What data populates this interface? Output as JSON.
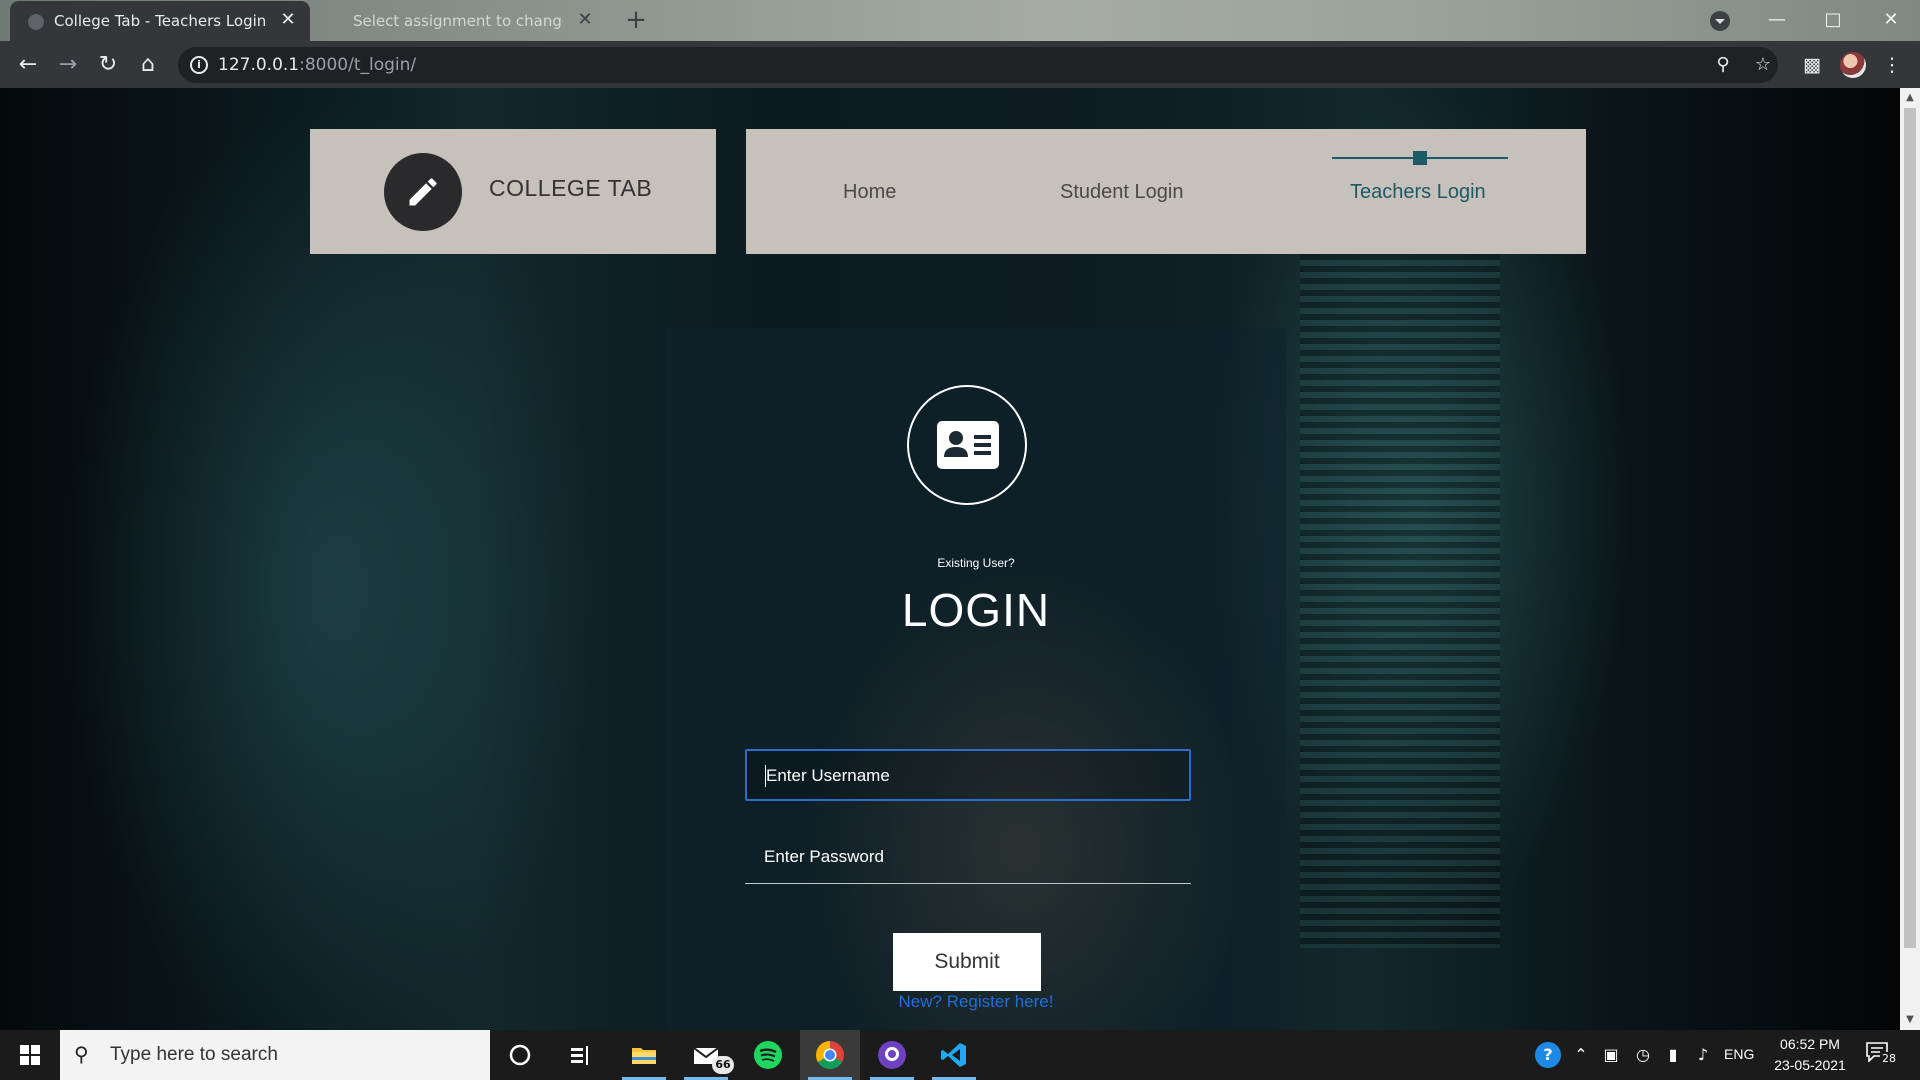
{
  "browser": {
    "tabs": [
      {
        "title": "College Tab - Teachers Login",
        "active": true
      },
      {
        "title": "Select assignment to change | Django",
        "active": false
      }
    ],
    "close_glyph": "✕",
    "new_tab_glyph": "+",
    "url_host": "127.0.0.1",
    "url_rest": ":8000/t_login/",
    "icons": {
      "back": "back-arrow-icon",
      "forward": "forward-arrow-icon",
      "reload": "reload-icon",
      "home": "home-icon",
      "info": "info-icon",
      "zoom": "zoom-icon",
      "bookmark": "star-icon",
      "extensions": "puzzle-icon",
      "menu": "kebab-menu-icon"
    }
  },
  "site": {
    "brand": "COLLEGE TAB",
    "nav": [
      {
        "label": "Home",
        "active": false
      },
      {
        "label": "Student Login",
        "active": false
      },
      {
        "label": "Teachers Login",
        "active": true
      }
    ],
    "accent_color": "#1d5a66"
  },
  "login": {
    "existing_text": "Existing User?",
    "title": "LOGIN",
    "username_placeholder": "Enter Username",
    "password_placeholder": "Enter Password",
    "submit_label": "Submit",
    "register_link": "New? Register here!",
    "link_color": "#1e6fd9"
  },
  "taskbar": {
    "search_placeholder": "Type here to search",
    "mail_badge": "66",
    "language": "ENG",
    "time": "06:52 PM",
    "date": "23-05-2021",
    "notifications": "28"
  }
}
